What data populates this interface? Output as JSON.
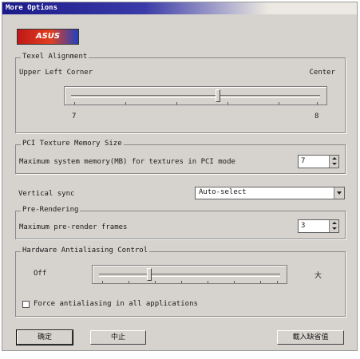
{
  "window": {
    "title": "More Options",
    "logo_text": "ASUS"
  },
  "texel": {
    "group_label": "Texel Alignment",
    "left_label": "Upper Left Corner",
    "right_label": "Center",
    "min_value": "7",
    "max_value": "8",
    "slider_fraction": 0.59
  },
  "pci": {
    "group_label": "PCI Texture Memory Size",
    "field_label": "Maximum system memory(MB) for textures in PCI mode",
    "value": "7"
  },
  "vsync": {
    "label": "Vertical sync",
    "value": "Auto-select"
  },
  "prerender": {
    "group_label": "Pre-Rendering",
    "field_label": "Maximum pre-render frames",
    "value": "3"
  },
  "antialias": {
    "group_label": "Hardware Antialiasing Control",
    "left_label": "Off",
    "right_label": "大",
    "slider_fraction": 0.27,
    "force_label": "Force antialiasing in all applications",
    "force_checked": false
  },
  "buttons": {
    "ok": "确定",
    "cancel": "中止",
    "defaults": "載入缺省值"
  }
}
